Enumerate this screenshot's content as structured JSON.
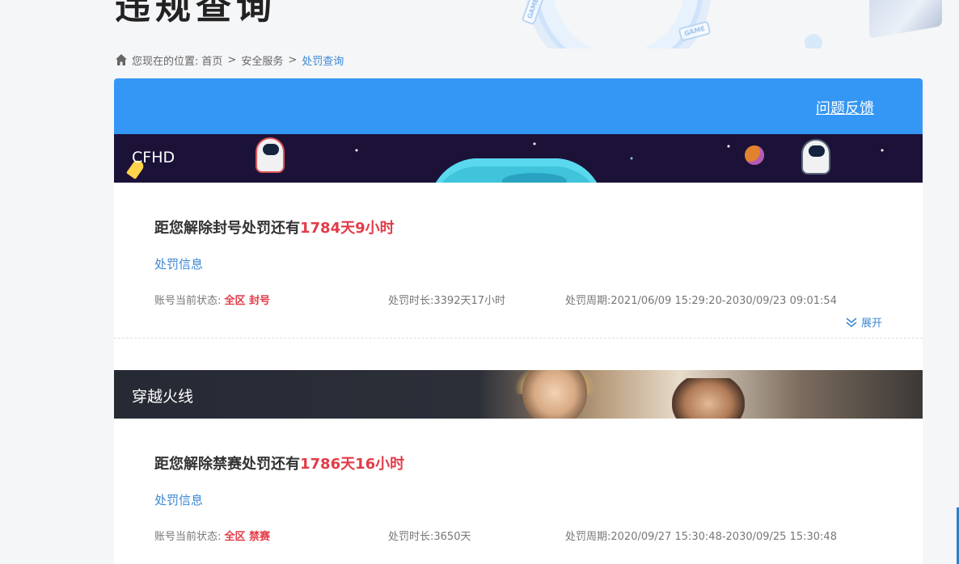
{
  "top_banner": {
    "title_cut": "违规查询",
    "tag1": "GAME",
    "tag2": "GAME"
  },
  "breadcrumb": {
    "prefix": "您现在的位置:",
    "items": [
      "首页",
      "安全服务",
      "处罚查询"
    ],
    "separator": ">"
  },
  "panel": {
    "feedback": "问题反馈"
  },
  "records": [
    {
      "game": "CFHD",
      "countdown_prefix": "距您解除封号处罚还有",
      "countdown_value": "1784天9小时",
      "info_link": "处罚信息",
      "status_label": "账号当前状态:",
      "status_value": "全区 封号",
      "duration_label": "处罚时长:",
      "duration_value": "3392天17小时",
      "period_label": "处罚周期:",
      "period_value": "2021/06/09 15:29:20-2030/09/23 09:01:54",
      "expand": "展开"
    },
    {
      "game": "穿越火线",
      "countdown_prefix": "距您解除禁赛处罚还有",
      "countdown_value": "1786天16小时",
      "info_link": "处罚信息",
      "status_label": "账号当前状态:",
      "status_value": "全区 禁赛",
      "duration_label": "处罚时长:",
      "duration_value": "3650天",
      "period_label": "处罚周期:",
      "period_value": "2020/09/27 15:30:48-2030/09/25 15:30:48"
    }
  ],
  "colors": {
    "header_blue": "#3597f5",
    "link_blue": "#3b88d4",
    "alert_red": "#e23c48"
  }
}
